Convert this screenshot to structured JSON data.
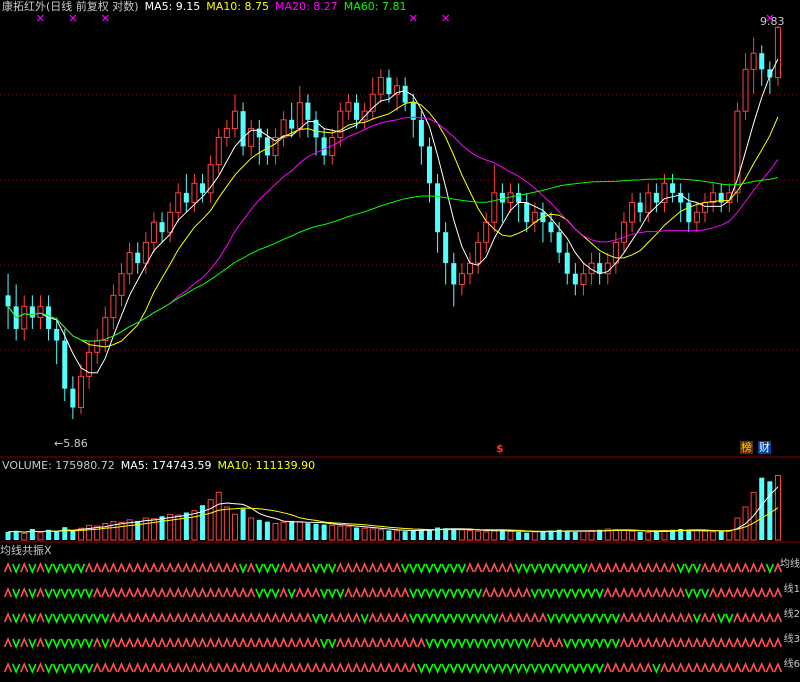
{
  "colors": {
    "background": "#000000",
    "up": "#ff4040",
    "down": "#54ffff",
    "ma5": "#ffffff",
    "ma10": "#ffff00",
    "ma20": "#ff00ff",
    "ma60": "#00ff00",
    "grid": "#8b0000",
    "signal_up": "#ff5050",
    "signal_down": "#00ff00"
  },
  "header": {
    "title": "康拓红外(日线 前复权 对数)",
    "ma5": "MA5: 9.15",
    "ma10": "MA10: 8.75",
    "ma20": "MA20: 8.27",
    "ma60": "MA60: 7.81"
  },
  "price_panel": {
    "high_label": "9.83",
    "low_label": "5.86",
    "low_arrow": "←",
    "marker_dollar": "$",
    "badge_bang": "榜",
    "badge_cai": "财"
  },
  "volume_panel": {
    "volume": "VOLUME: 175980.72",
    "ma5": "MA5: 174743.59",
    "ma10": "MA10: 111139.90"
  },
  "indicator_panel": {
    "title": "均线共振X",
    "rows": [
      {
        "label": "均线"
      },
      {
        "label": "线1"
      },
      {
        "label": "线2"
      },
      {
        "label": "线3"
      },
      {
        "label": "线6"
      }
    ]
  },
  "chart_data": {
    "type": "candlestick",
    "scale": "log",
    "ylim": [
      5.7,
      9.9
    ],
    "candles": [
      [
        6.9,
        6.8,
        7.1,
        6.6
      ],
      [
        6.8,
        6.6,
        7.0,
        6.5
      ],
      [
        6.6,
        6.8,
        6.9,
        6.5
      ],
      [
        6.8,
        6.7,
        6.9,
        6.6
      ],
      [
        6.7,
        6.8,
        6.9,
        6.6
      ],
      [
        6.8,
        6.6,
        6.9,
        6.5
      ],
      [
        6.6,
        6.5,
        6.7,
        6.3
      ],
      [
        6.5,
        6.1,
        6.6,
        6.0
      ],
      [
        6.1,
        5.95,
        6.2,
        5.86
      ],
      [
        5.95,
        6.2,
        6.3,
        5.9
      ],
      [
        6.2,
        6.4,
        6.5,
        6.1
      ],
      [
        6.4,
        6.5,
        6.6,
        6.3
      ],
      [
        6.5,
        6.7,
        6.8,
        6.4
      ],
      [
        6.7,
        6.9,
        7.0,
        6.6
      ],
      [
        6.9,
        7.1,
        7.2,
        6.8
      ],
      [
        7.1,
        7.3,
        7.4,
        7.0
      ],
      [
        7.3,
        7.2,
        7.4,
        7.1
      ],
      [
        7.2,
        7.4,
        7.5,
        7.1
      ],
      [
        7.4,
        7.6,
        7.7,
        7.3
      ],
      [
        7.6,
        7.5,
        7.7,
        7.4
      ],
      [
        7.5,
        7.7,
        7.8,
        7.4
      ],
      [
        7.7,
        7.9,
        8.0,
        7.6
      ],
      [
        7.9,
        7.8,
        8.1,
        7.7
      ],
      [
        7.8,
        8.0,
        8.1,
        7.7
      ],
      [
        8.0,
        7.9,
        8.1,
        7.8
      ],
      [
        7.9,
        8.2,
        8.3,
        7.8
      ],
      [
        8.2,
        8.5,
        8.6,
        8.1
      ],
      [
        8.5,
        8.6,
        8.7,
        8.4
      ],
      [
        8.6,
        8.8,
        9.0,
        8.5
      ],
      [
        8.8,
        8.4,
        8.9,
        8.3
      ],
      [
        8.4,
        8.6,
        8.7,
        8.3
      ],
      [
        8.6,
        8.5,
        8.7,
        8.2
      ],
      [
        8.5,
        8.3,
        8.6,
        8.2
      ],
      [
        8.3,
        8.5,
        8.6,
        8.2
      ],
      [
        8.5,
        8.7,
        8.8,
        8.4
      ],
      [
        8.7,
        8.6,
        8.9,
        8.5
      ],
      [
        8.6,
        8.9,
        9.1,
        8.5
      ],
      [
        8.9,
        8.7,
        9.0,
        8.5
      ],
      [
        8.7,
        8.5,
        8.8,
        8.3
      ],
      [
        8.5,
        8.3,
        8.6,
        8.2
      ],
      [
        8.3,
        8.5,
        8.6,
        8.2
      ],
      [
        8.5,
        8.8,
        8.9,
        8.4
      ],
      [
        8.8,
        8.9,
        9.0,
        8.7
      ],
      [
        8.9,
        8.7,
        9.0,
        8.6
      ],
      [
        8.7,
        8.8,
        8.9,
        8.6
      ],
      [
        8.8,
        9.0,
        9.2,
        8.7
      ],
      [
        9.0,
        9.2,
        9.3,
        8.9
      ],
      [
        9.2,
        9.0,
        9.3,
        8.9
      ],
      [
        9.0,
        9.1,
        9.2,
        8.8
      ],
      [
        9.1,
        8.9,
        9.2,
        8.8
      ],
      [
        8.9,
        8.7,
        9.0,
        8.5
      ],
      [
        8.7,
        8.4,
        8.8,
        8.2
      ],
      [
        8.4,
        8.0,
        8.5,
        7.8
      ],
      [
        8.0,
        7.5,
        8.1,
        7.3
      ],
      [
        7.5,
        7.2,
        7.6,
        7.0
      ],
      [
        7.2,
        7.0,
        7.3,
        6.8
      ],
      [
        7.0,
        7.1,
        7.2,
        6.9
      ],
      [
        7.1,
        7.2,
        7.3,
        7.0
      ],
      [
        7.2,
        7.4,
        7.5,
        7.1
      ],
      [
        7.4,
        7.6,
        7.7,
        7.3
      ],
      [
        7.6,
        7.9,
        8.2,
        7.5
      ],
      [
        7.9,
        7.8,
        8.0,
        7.6
      ],
      [
        7.8,
        7.9,
        8.0,
        7.7
      ],
      [
        7.9,
        7.8,
        8.0,
        7.6
      ],
      [
        7.8,
        7.6,
        7.9,
        7.5
      ],
      [
        7.6,
        7.7,
        7.8,
        7.5
      ],
      [
        7.7,
        7.6,
        7.8,
        7.4
      ],
      [
        7.6,
        7.5,
        7.7,
        7.4
      ],
      [
        7.5,
        7.3,
        7.6,
        7.2
      ],
      [
        7.3,
        7.1,
        7.4,
        7.0
      ],
      [
        7.1,
        7.0,
        7.2,
        6.9
      ],
      [
        7.0,
        7.1,
        7.2,
        6.9
      ],
      [
        7.1,
        7.2,
        7.3,
        7.0
      ],
      [
        7.2,
        7.1,
        7.3,
        7.0
      ],
      [
        7.1,
        7.2,
        7.3,
        7.0
      ],
      [
        7.2,
        7.4,
        7.5,
        7.1
      ],
      [
        7.4,
        7.6,
        7.7,
        7.3
      ],
      [
        7.6,
        7.8,
        7.9,
        7.5
      ],
      [
        7.8,
        7.7,
        7.9,
        7.6
      ],
      [
        7.7,
        7.9,
        8.0,
        7.6
      ],
      [
        7.9,
        7.8,
        8.0,
        7.7
      ],
      [
        7.8,
        8.0,
        8.1,
        7.7
      ],
      [
        8.0,
        7.9,
        8.1,
        7.8
      ],
      [
        7.9,
        7.8,
        8.0,
        7.6
      ],
      [
        7.8,
        7.6,
        7.9,
        7.5
      ],
      [
        7.6,
        7.7,
        7.8,
        7.5
      ],
      [
        7.7,
        7.8,
        7.9,
        7.6
      ],
      [
        7.8,
        7.9,
        8.0,
        7.7
      ],
      [
        7.9,
        7.8,
        8.0,
        7.7
      ],
      [
        7.8,
        7.9,
        8.0,
        7.7
      ],
      [
        7.9,
        8.8,
        8.9,
        7.8
      ],
      [
        8.8,
        9.3,
        9.5,
        8.7
      ],
      [
        9.3,
        9.5,
        9.7,
        9.0
      ],
      [
        9.5,
        9.3,
        9.6,
        9.1
      ],
      [
        9.3,
        9.2,
        9.4,
        9.0
      ],
      [
        9.2,
        9.83,
        9.85,
        9.1
      ]
    ],
    "volume": [
      22,
      25,
      18,
      30,
      20,
      28,
      24,
      35,
      26,
      32,
      40,
      38,
      45,
      50,
      48,
      55,
      52,
      60,
      58,
      65,
      70,
      68,
      75,
      80,
      95,
      110,
      130,
      90,
      70,
      85,
      60,
      55,
      50,
      45,
      48,
      52,
      50,
      46,
      44,
      42,
      40,
      38,
      36,
      34,
      32,
      30,
      28,
      26,
      25,
      24,
      26,
      30,
      28,
      34,
      32,
      30,
      28,
      26,
      24,
      22,
      25,
      28,
      24,
      22,
      20,
      22,
      24,
      26,
      28,
      24,
      22,
      24,
      26,
      28,
      30,
      28,
      26,
      24,
      22,
      20,
      24,
      26,
      28,
      30,
      28,
      26,
      24,
      22,
      24,
      26,
      60,
      90,
      130,
      170,
      160,
      176
    ],
    "volume_ylim": [
      0,
      180
    ],
    "signal_rows": 5
  }
}
